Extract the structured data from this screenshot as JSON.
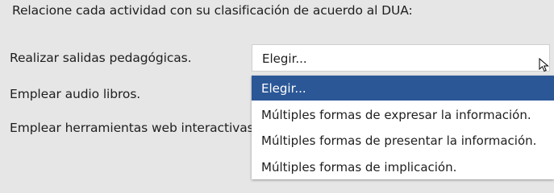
{
  "question": "Relacione cada actividad con su clasificación de acuerdo al DUA:",
  "rows": [
    {
      "label": "Realizar salidas pedagógicas."
    },
    {
      "label": "Emplear audio libros."
    },
    {
      "label": "Emplear herramientas web interactivas."
    }
  ],
  "select": {
    "value": "Elegir..."
  },
  "dropdown": {
    "selected": "Elegir...",
    "options": [
      "Múltiples formas de expresar la información.",
      "Múltiples formas de presentar la información.",
      "Múltiples formas de implicación."
    ]
  },
  "colors": {
    "highlight": "#2b5797",
    "background": "#e6e6e6"
  }
}
